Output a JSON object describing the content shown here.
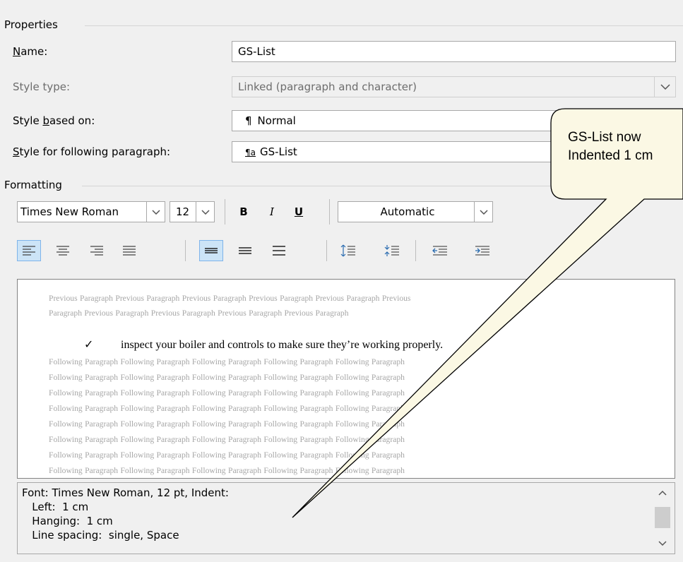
{
  "properties": {
    "group_title": "Properties",
    "name_label": "Name:",
    "name_value": "GS-List",
    "style_type_label": "Style type:",
    "style_type_value": "Linked (paragraph and character)",
    "based_on_label": "Style based on:",
    "based_on_value": "Normal",
    "following_label": "Style for following paragraph:",
    "following_value": "GS-List"
  },
  "formatting": {
    "group_title": "Formatting",
    "font_name": "Times New Roman",
    "font_size": "12",
    "bold": "B",
    "italic": "I",
    "underline": "U",
    "color": "Automatic"
  },
  "preview": {
    "previous_1": "Previous Paragraph Previous Paragraph Previous Paragraph Previous Paragraph Previous Paragraph Previous",
    "previous_2": "Paragraph Previous Paragraph Previous Paragraph Previous Paragraph Previous Paragraph",
    "bullet": "✓",
    "sample_text": "inspect your boiler and controls to make sure they’re working properly.",
    "following_line": "Following Paragraph Following Paragraph Following Paragraph Following Paragraph Following Paragraph"
  },
  "description": {
    "line1": "Font: Times New Roman, 12 pt, Indent:",
    "line2": "   Left:  1 cm",
    "line3": "   Hanging:  1 cm",
    "line4": "   Line spacing:  single, Space"
  },
  "callout": {
    "line1": "GS-List now",
    "line2": "Indented 1 cm"
  }
}
